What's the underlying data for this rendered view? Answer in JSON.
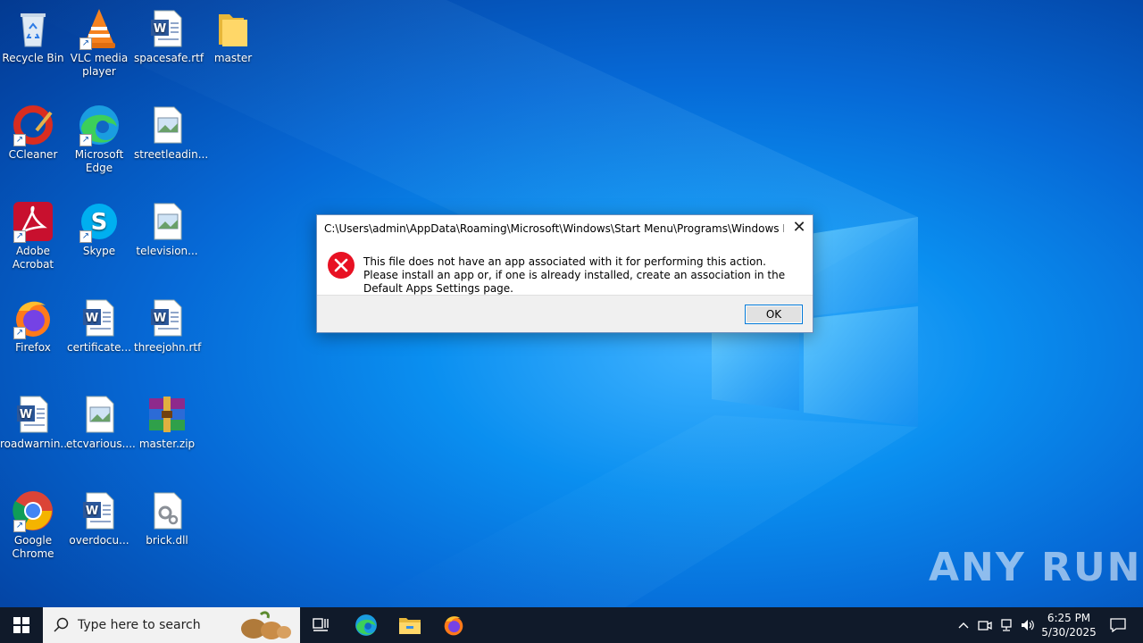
{
  "desktop": {
    "icons": [
      {
        "label": "Recycle Bin"
      },
      {
        "label": "VLC media player"
      },
      {
        "label": "spacesafe.rtf"
      },
      {
        "label": "master"
      },
      {
        "label": "CCleaner"
      },
      {
        "label": "Microsoft Edge"
      },
      {
        "label": "streetleadin..."
      },
      {
        "label": "Adobe Acrobat"
      },
      {
        "label": "Skype"
      },
      {
        "label": "television..."
      },
      {
        "label": "Firefox"
      },
      {
        "label": "certificate..."
      },
      {
        "label": "threejohn.rtf"
      },
      {
        "label": "roadwarnin..."
      },
      {
        "label": "etcvarious...."
      },
      {
        "label": "master.zip"
      },
      {
        "label": "Google Chrome"
      },
      {
        "label": "overdocu..."
      },
      {
        "label": "brick.dll"
      }
    ]
  },
  "dialog": {
    "title": "C:\\Users\\admin\\AppData\\Roaming\\Microsoft\\Windows\\Start Menu\\Programs\\Windows Power...",
    "message": "This file does not have an app associated with it for performing this action. Please install an app or, if one is already installed, create an association in the Default Apps Settings page.",
    "ok_label": "OK",
    "close_glyph": "✕",
    "icon": "error-icon"
  },
  "taskbar": {
    "search_placeholder": "Type here to search",
    "time": "6:25 PM",
    "date": "5/30/2025"
  },
  "watermark": "ANY RUN",
  "colors": {
    "error_red": "#e81123",
    "accent_blue": "#0078d7",
    "taskbar_bg": "#101a2a"
  }
}
